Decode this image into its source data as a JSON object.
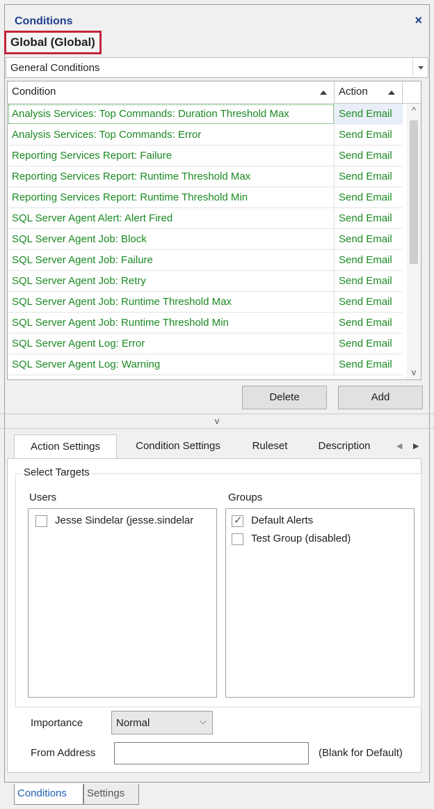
{
  "header": {
    "title": "Conditions",
    "close_glyph": "×",
    "scope": "Global (Global)"
  },
  "category": {
    "value": "General Conditions"
  },
  "grid": {
    "columns": [
      "Condition",
      "Action"
    ],
    "rows": [
      {
        "condition": "Analysis Services: Top Commands: Duration Threshold Max",
        "action": "Send Email"
      },
      {
        "condition": "Analysis Services: Top Commands: Error",
        "action": "Send Email"
      },
      {
        "condition": "Reporting Services Report: Failure",
        "action": "Send Email"
      },
      {
        "condition": "Reporting Services Report: Runtime Threshold Max",
        "action": "Send Email"
      },
      {
        "condition": "Reporting Services Report: Runtime Threshold Min",
        "action": "Send Email"
      },
      {
        "condition": "SQL Server Agent Alert: Alert Fired",
        "action": "Send Email"
      },
      {
        "condition": "SQL Server Agent Job: Block",
        "action": "Send Email"
      },
      {
        "condition": "SQL Server Agent Job: Failure",
        "action": "Send Email"
      },
      {
        "condition": "SQL Server Agent Job: Retry",
        "action": "Send Email"
      },
      {
        "condition": "SQL Server Agent Job: Runtime Threshold Max",
        "action": "Send Email"
      },
      {
        "condition": "SQL Server Agent Job: Runtime Threshold Min",
        "action": "Send Email"
      },
      {
        "condition": "SQL Server Agent Log: Error",
        "action": "Send Email"
      },
      {
        "condition": "SQL Server Agent Log: Warning",
        "action": "Send Email"
      }
    ],
    "scroll_up": "^",
    "scroll_down": "v"
  },
  "buttons": {
    "delete": "Delete",
    "add": "Add"
  },
  "splitter_glyph": "v",
  "tabs": [
    "Action Settings",
    "Condition Settings",
    "Ruleset",
    "Description"
  ],
  "tab_arrows": {
    "left": "◀",
    "right": "▶"
  },
  "action_settings": {
    "group_title": "Select Targets",
    "users_label": "Users",
    "groups_label": "Groups",
    "users": [
      {
        "name": "Jesse Sindelar (jesse.sindelar",
        "checked": false
      }
    ],
    "groups": [
      {
        "name": "Default Alerts",
        "checked": true
      },
      {
        "name": "Test Group (disabled)",
        "checked": false
      }
    ],
    "check_glyph": "✓",
    "importance_label": "Importance",
    "importance_value": "Normal",
    "importance_chevron": "⌵",
    "from_address_label": "From Address",
    "from_address_value": "",
    "from_address_hint": "(Blank for Default)"
  },
  "bottom_tabs": [
    "Conditions",
    "Settings"
  ],
  "colors": {
    "title": "#1f3f8f",
    "row_text": "#1a8a22",
    "scope_border": "#c4243a",
    "active_bottom_tab": "#1f5fb4"
  }
}
